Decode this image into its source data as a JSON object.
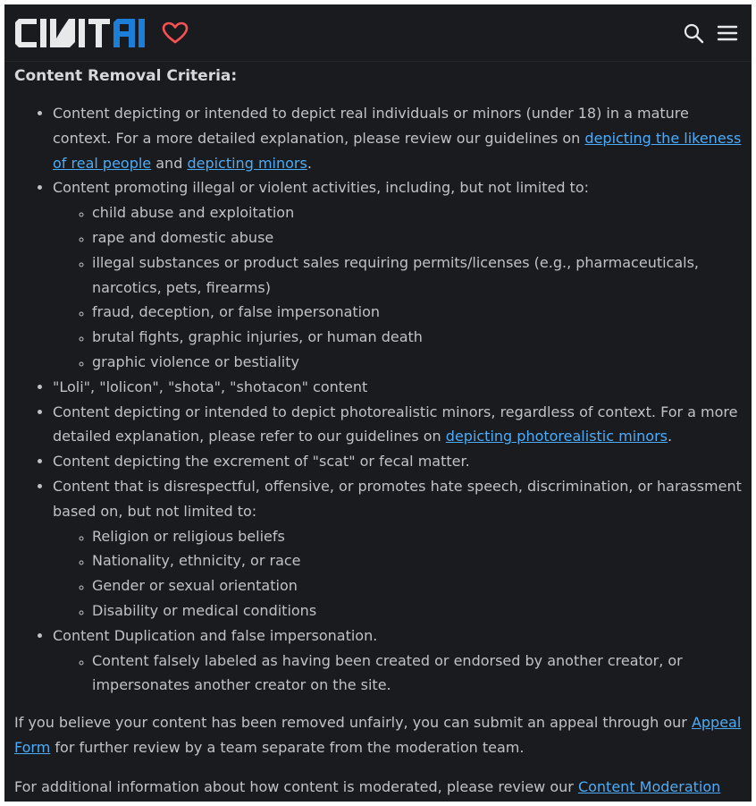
{
  "header": {
    "logo_text": "CIVITAI",
    "favorite_icon": "heart-icon",
    "search_icon": "search-icon",
    "menu_icon": "hamburger-menu-icon",
    "brand_color_light": "#e7e8ea",
    "brand_color_blue": "#1c7ed6",
    "heart_color": "#fa5252"
  },
  "title": "Content Removal Criteria:",
  "criteria": {
    "item1": {
      "text_before": "Content depicting or intended to depict real individuals or minors (under 18) in a mature context. For a more detailed explanation, please review our guidelines on ",
      "link1": "depicting the likeness of real people",
      "text_middle": " and ",
      "link2": "depicting minors",
      "text_after": "."
    },
    "item2": {
      "text": "Content promoting illegal or violent activities, including, but not limited to:",
      "subitems": [
        "child abuse and exploitation",
        "rape and domestic abuse",
        "illegal substances or product sales requiring permits/licenses (e.g., pharmaceuticals, narcotics, pets, firearms)",
        "fraud, deception, or false impersonation",
        "brutal fights, graphic injuries, or human death",
        "graphic violence or bestiality"
      ]
    },
    "item3": {
      "text": "\"Loli\", \"lolicon\", \"shota\", \"shotacon\" content"
    },
    "item4": {
      "text_before": "Content depicting or intended to depict photorealistic minors, regardless of context. For a more detailed explanation, please refer to our guidelines on ",
      "link": "depicting photorealistic minors",
      "text_after": "."
    },
    "item5": {
      "text": "Content depicting the excrement of \"scat\" or fecal matter."
    },
    "item6": {
      "text": "Content that is disrespectful, offensive, or promotes hate speech, discrimination, or harassment based on, but not limited to:",
      "subitems": [
        "Religion or religious beliefs",
        "Nationality, ethnicity, or race",
        "Gender or sexual orientation",
        "Disability or medical conditions"
      ]
    },
    "item7": {
      "text": "Content Duplication and false impersonation.",
      "subitems": [
        "Content falsely labeled as having been created or endorsed by another creator, or impersonates another creator on the site."
      ]
    }
  },
  "appeal": {
    "text_before": "If you believe your content has been removed unfairly, you can submit an appeal through our ",
    "link": "Appeal Form",
    "text_after": " for further review by a team separate from the moderation team."
  },
  "moderation": {
    "text_before": "For additional information about how content is moderated, please review our ",
    "link": "Content Moderation Policy",
    "text_after": "."
  }
}
